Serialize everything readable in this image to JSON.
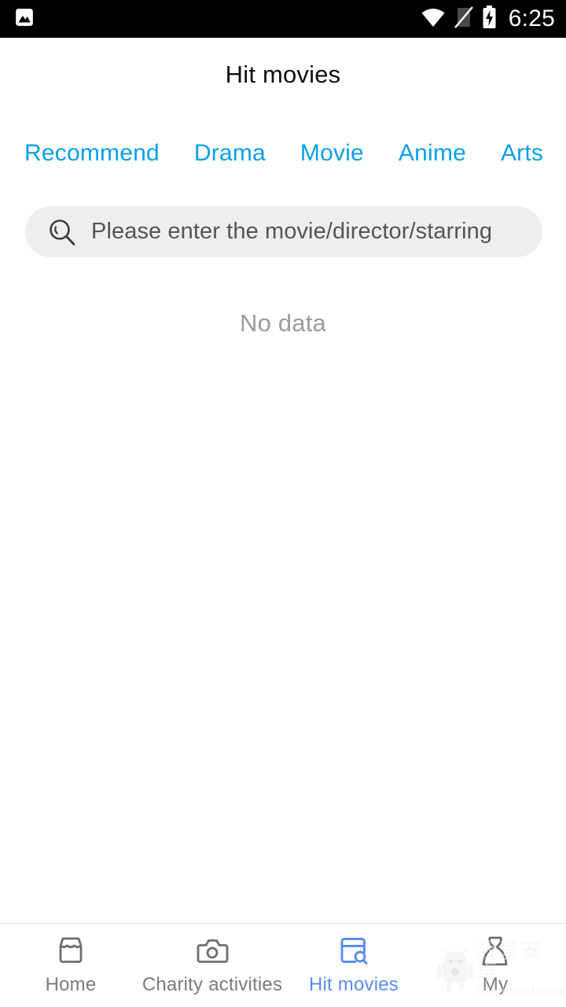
{
  "status_bar": {
    "notification_icon": "image-photo-icon",
    "wifi_icon": "wifi-icon",
    "signal_icon": "no-sim-signal-icon",
    "battery_icon": "battery-charging-icon",
    "time": "6:25"
  },
  "header": {
    "title": "Hit movies"
  },
  "tabs": [
    {
      "label": "Recommend",
      "active": false
    },
    {
      "label": "Drama",
      "active": false
    },
    {
      "label": "Movie",
      "active": false
    },
    {
      "label": "Anime",
      "active": false
    },
    {
      "label": "Arts",
      "active": false
    }
  ],
  "search": {
    "icon": "search-icon",
    "value": "",
    "placeholder": "Please enter the movie/director/starring"
  },
  "content": {
    "empty_message": "No data"
  },
  "bottom_nav": [
    {
      "label": "Home",
      "icon": "store-icon",
      "active": false
    },
    {
      "label": "Charity activities",
      "icon": "camera-icon",
      "active": false
    },
    {
      "label": "Hit movies",
      "icon": "browser-search-icon",
      "active": true
    },
    {
      "label": "My",
      "icon": "person-icon",
      "active": false
    }
  ],
  "watermark": {
    "text_cn": "我爱安卓",
    "url": "52android.com",
    "icon": "android-robot-icon"
  },
  "colors": {
    "tab_blue": "#0c9fe8",
    "nav_active_blue": "#5b8def",
    "status_bar_bg": "#000000",
    "search_bg": "#eeeeee",
    "empty_text": "#9b9b9b",
    "nav_inactive": "#7b7b7b"
  }
}
